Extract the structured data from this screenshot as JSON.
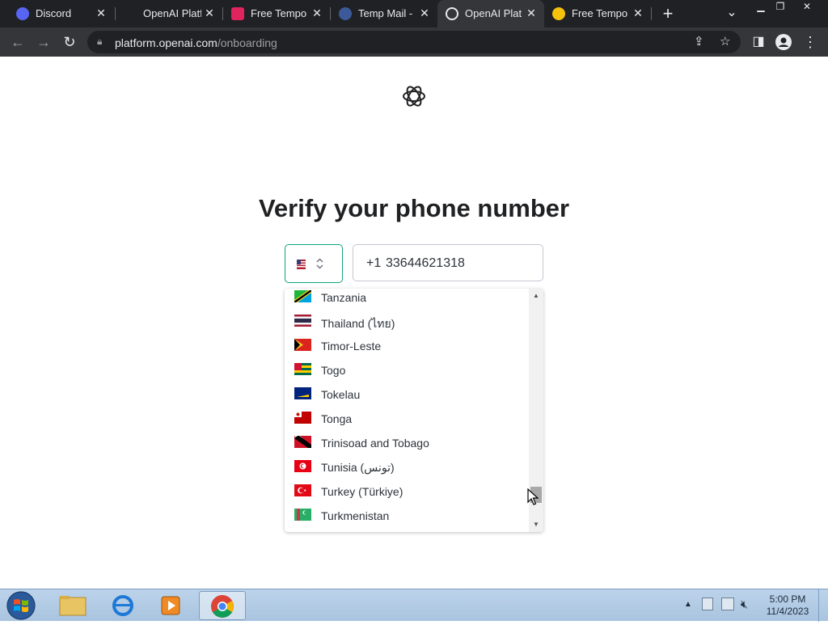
{
  "browser": {
    "tabs": [
      {
        "title": "Discord",
        "active": false
      },
      {
        "title": "OpenAI Platf",
        "active": false
      },
      {
        "title": "Free Tempor",
        "active": false
      },
      {
        "title": "Temp Mail - ",
        "active": false
      },
      {
        "title": "OpenAI Platf",
        "active": true
      },
      {
        "title": "Free Tempor",
        "active": false
      }
    ],
    "new_tab_label": "+",
    "tab_list_label": "⌄",
    "url_domain": "platform.openai.com",
    "url_path": "/onboarding"
  },
  "page": {
    "title": "Verify your phone number",
    "selected_country_flag": "us-flag",
    "phone_prefix": "+1",
    "phone_value": "33644621318"
  },
  "dropdown": {
    "options": [
      {
        "name": "Tanzania",
        "flag": "tz"
      },
      {
        "name": "Thailand (ไทย)",
        "flag": "th"
      },
      {
        "name": "Timor-Leste",
        "flag": "tl"
      },
      {
        "name": "Togo",
        "flag": "tg"
      },
      {
        "name": "Tokelau",
        "flag": "tk"
      },
      {
        "name": "Tonga",
        "flag": "to"
      },
      {
        "name": "Trinisoad and Tobago",
        "flag": "tt"
      },
      {
        "name": "Tunisia (تونس)",
        "flag": "tn"
      },
      {
        "name": "Turkey (Türkiye)",
        "flag": "tr"
      },
      {
        "name": "Turkmenistan",
        "flag": "tm"
      }
    ]
  },
  "taskbar": {
    "clock_time": "5:00 PM",
    "clock_date": "11/4/2023"
  },
  "colors": {
    "accent": "#10a37f",
    "chrome_dark": "#202124",
    "chrome_toolbar": "#35363a"
  }
}
